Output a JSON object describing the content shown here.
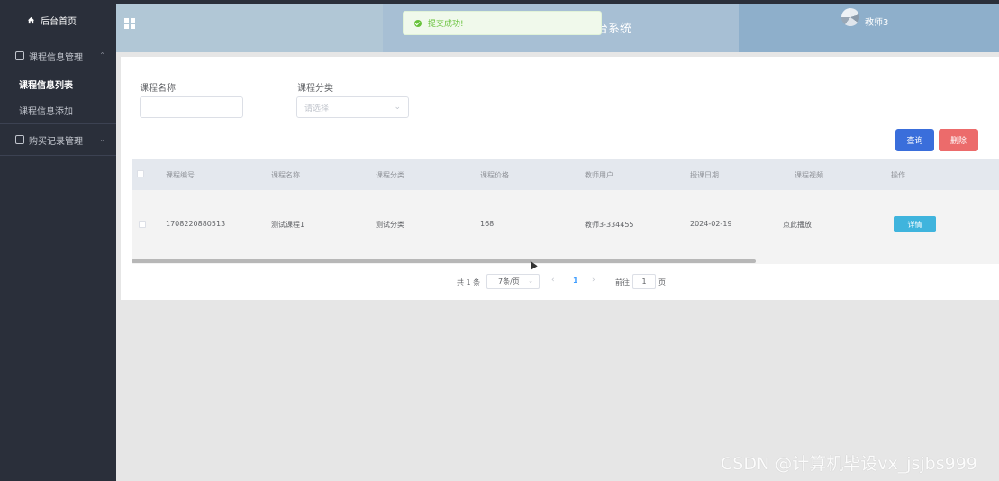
{
  "sidebar": {
    "home_label": "后台首页",
    "groups": [
      {
        "label": "课程信息管理",
        "items": [
          {
            "label": "课程信息列表",
            "active": true
          },
          {
            "label": "课程信息添加",
            "active": false
          }
        ]
      },
      {
        "label": "购买记录管理",
        "items": []
      }
    ]
  },
  "header": {
    "title_fragment": "台系统",
    "user_name": "教师3"
  },
  "toast": {
    "message": "提交成功!"
  },
  "search": {
    "name_label": "课程名称",
    "name_value": "",
    "category_label": "课程分类",
    "category_placeholder": "请选择",
    "query_button": "查询",
    "delete_button": "删除"
  },
  "table": {
    "headers": [
      "课程编号",
      "课程名称",
      "课程分类",
      "课程价格",
      "教师用户",
      "授课日期",
      "课程视频",
      "操作"
    ],
    "rows": [
      {
        "id": "1708220880513",
        "name": "测试课程1",
        "category": "测试分类",
        "price": "168",
        "teacher": "教师3-334455",
        "date": "2024-02-19",
        "video": "点此播放",
        "action": "详情"
      }
    ]
  },
  "pagination": {
    "total_text": "共 1 条",
    "page_size": "7条/页",
    "current_page": "1",
    "goto_label": "前往",
    "goto_value": "1",
    "page_suffix": "页"
  },
  "watermark": "CSDN @计算机毕设vx_jsjbs999",
  "colors": {
    "sidebar_bg": "#2a2f3a",
    "primary": "#3a6edb",
    "danger": "#ec6b6b",
    "info": "#3fb4dd",
    "success": "#67c23a"
  }
}
